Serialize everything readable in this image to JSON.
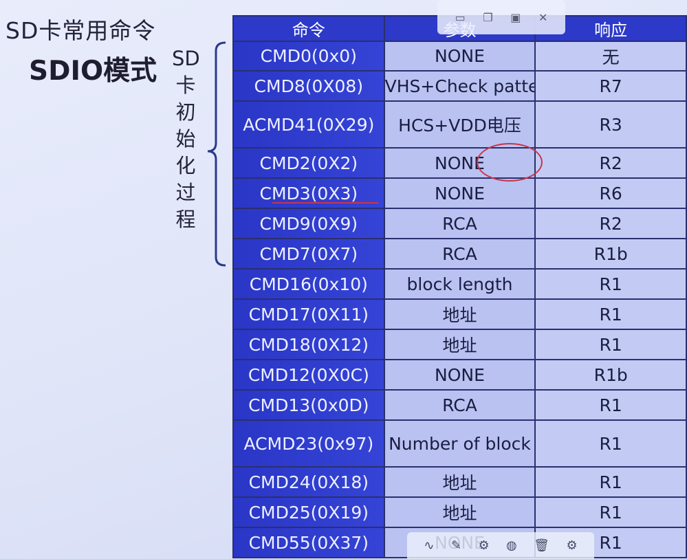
{
  "titles": {
    "line1": "SD卡常用命令",
    "line2": "SDIO模式"
  },
  "side_label_chars": [
    "SD",
    "卡",
    "初",
    "始",
    "化",
    "过",
    "程"
  ],
  "table": {
    "headers": [
      "命令",
      "参数",
      "响应"
    ],
    "rows": [
      [
        "CMD0(0x0)",
        "NONE",
        "无"
      ],
      [
        "CMD8(0X08)",
        "VHS+Check pattern",
        "R7"
      ],
      [
        "ACMD41(0X29)",
        "HCS+VDD电压",
        "R3"
      ],
      [
        "CMD2(0X2)",
        "NONE",
        "R2"
      ],
      [
        "CMD3(0X3)",
        "NONE",
        "R6"
      ],
      [
        "CMD9(0X9)",
        "RCA",
        "R2"
      ],
      [
        "CMD7(0X7)",
        "RCA",
        "R1b"
      ],
      [
        "CMD16(0x10)",
        "block length",
        "R1"
      ],
      [
        "CMD17(0X11)",
        "地址",
        "R1"
      ],
      [
        "CMD18(0X12)",
        "地址",
        "R1"
      ],
      [
        "CMD12(0X0C)",
        "NONE",
        "R1b"
      ],
      [
        "CMD13(0x0D)",
        "RCA",
        "R1"
      ],
      [
        "ACMD23(0x97)",
        "Number of block",
        "R1"
      ],
      [
        "CMD24(0X18)",
        "地址",
        "R1"
      ],
      [
        "CMD25(0X19)",
        "地址",
        "R1"
      ],
      [
        "CMD55(0X37)",
        "NONE",
        "R1"
      ]
    ]
  },
  "window_controls": [
    "minimize-icon",
    "restore-icon",
    "save-icon",
    "close-icon"
  ],
  "toolbar_icons": [
    "pen-icon",
    "brush-settings-icon",
    "eraser-settings-icon",
    "color-wheel-icon",
    "trash-icon",
    "settings-icon"
  ],
  "colors": {
    "header_blue": "#2d39c9",
    "annotation_red": "#c8354a"
  }
}
